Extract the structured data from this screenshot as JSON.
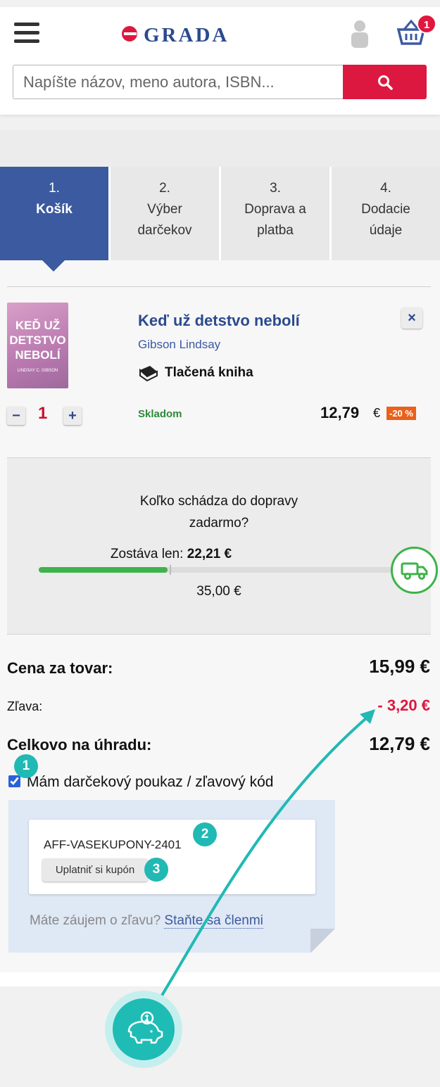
{
  "header": {
    "brand": "GRADA",
    "cart_count": "1",
    "search_placeholder": "Napíšte názov, meno autora, ISBN..."
  },
  "steps": [
    {
      "num": "1.",
      "label": "Košík"
    },
    {
      "num": "2.",
      "label": "Výber darčekov"
    },
    {
      "num": "3.",
      "label": "Doprava a platba"
    },
    {
      "num": "4.",
      "label": "Dodacie údaje"
    }
  ],
  "item": {
    "cover_title": "KEĎ UŽ DETSTVO NEBOLÍ",
    "cover_author": "LINDSAY C. GIBSON",
    "title": "Keď už detstvo nebolí",
    "author": "Gibson Lindsay",
    "format": "Tlačená kniha",
    "qty": "1",
    "stock": "Skladom",
    "price": "12,79",
    "currency": "€",
    "discount": "-20 %"
  },
  "shipping": {
    "question": "Koľko schádza do dopravy zadarmo?",
    "remaining_label": "Zostáva len:",
    "remaining_value": "22,21 €",
    "goal": "35,00 €",
    "progress_fraction": 0.3654
  },
  "summary": {
    "goods_label": "Cena za tovar:",
    "goods_value": "15,99 €",
    "discount_label": "Zľava:",
    "discount_value": "- 3,20 €",
    "total_label": "Celkovo na úhradu:",
    "total_value": "12,79 €"
  },
  "voucher": {
    "checkbox_label": "Mám darčekový poukaz / zľavový kód",
    "code": "AFF-VASEKUPONY-2401",
    "apply": "Uplatniť si kupón",
    "promo_text": "Máte záujem o zľavu?",
    "promo_link": "Staňte sa členmi"
  },
  "markers": [
    "1",
    "2",
    "3"
  ],
  "colors": {
    "primary": "#3b5aa0",
    "accent": "#dd1840",
    "teal": "#21b9b4",
    "green": "#3db34a"
  }
}
